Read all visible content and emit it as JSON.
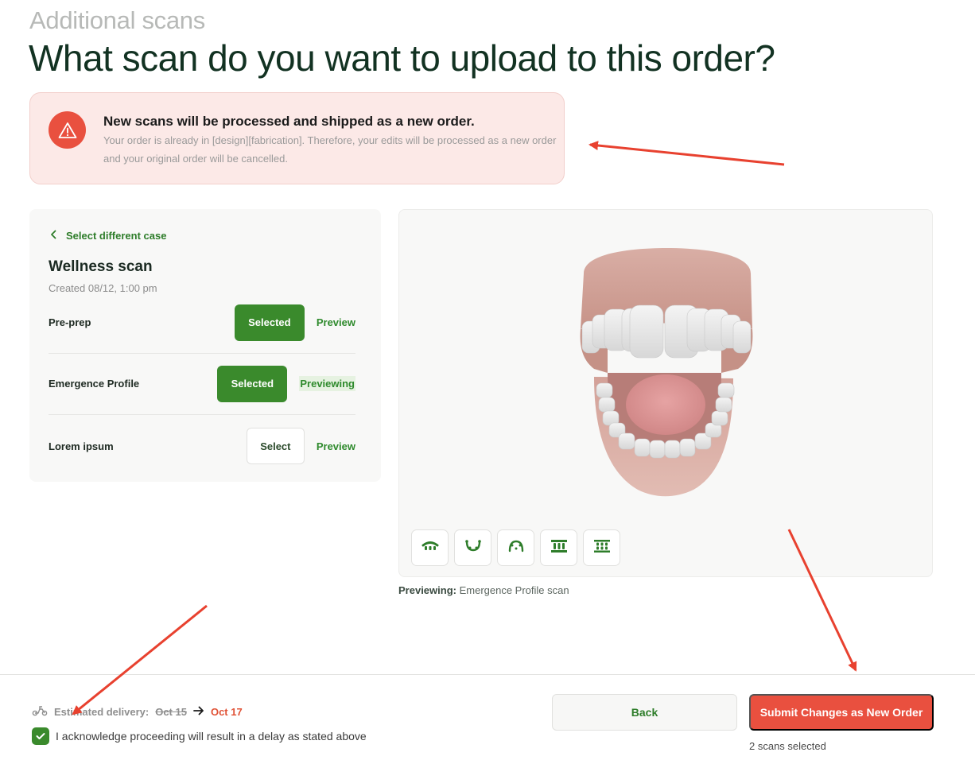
{
  "header": {
    "eyebrow": "Additional scans",
    "title": "What scan do you want to upload to this order?"
  },
  "alert": {
    "icon": "warning-triangle-icon",
    "title": "New scans will be processed and shipped as a new order.",
    "body": "Your order is already in [design][fabrication]. Therefore, your edits will be processed as a new order and your original order will be cancelled."
  },
  "case_panel": {
    "back_label": "Select different case",
    "case_title": "Wellness scan",
    "created": "Created 08/12, 1:00 pm",
    "scans": [
      {
        "name": "Pre-prep",
        "button": "Selected",
        "state": "selected",
        "link": "Preview"
      },
      {
        "name": "Emergence Profile",
        "button": "Selected",
        "state": "selected",
        "link": "Previewing"
      },
      {
        "name": "Lorem ipsum",
        "button": "Select",
        "state": "unselected",
        "link": "Preview"
      }
    ]
  },
  "viewer": {
    "tools": [
      "upper-arch-icon",
      "lower-arch-icon",
      "bite-open-icon",
      "front-view-icon",
      "occlusal-view-icon"
    ],
    "caption_label": "Previewing:",
    "caption_value": "Emergence Profile scan"
  },
  "footer": {
    "delivery_label": "Estimated delivery:",
    "old_date": "Oct 15",
    "new_date": "Oct 17",
    "ack_text": "I acknowledge proceeding will result in a delay as stated above",
    "ack_checked": true,
    "back_label": "Back",
    "submit_label": "Submit Changes as New Order",
    "scans_selected": "2 scans selected"
  },
  "colors": {
    "brand_green": "#3a8a2c",
    "alert_red": "#e9503f",
    "alert_bg": "#fce9e7",
    "annotation_arrow": "#e8412f"
  }
}
